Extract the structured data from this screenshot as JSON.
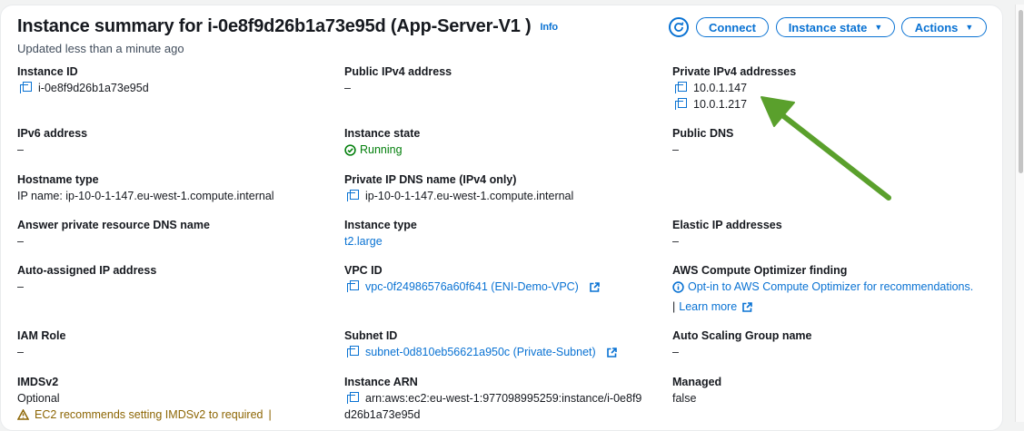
{
  "header": {
    "title": "Instance summary for i-0e8f9d26b1a73e95d (App-Server-V1 )",
    "info": "Info",
    "updated": "Updated less than a minute ago"
  },
  "buttons": {
    "connect": "Connect",
    "instance_state": "Instance state",
    "actions": "Actions"
  },
  "fields": {
    "instance_id": {
      "label": "Instance ID",
      "value": "i-0e8f9d26b1a73e95d"
    },
    "public_ipv4": {
      "label": "Public IPv4 address",
      "value": "–"
    },
    "private_ipv4": {
      "label": "Private IPv4 addresses",
      "values": [
        "10.0.1.147",
        "10.0.1.217"
      ]
    },
    "ipv6": {
      "label": "IPv6 address",
      "value": "–"
    },
    "instance_state": {
      "label": "Instance state",
      "value": "Running"
    },
    "public_dns": {
      "label": "Public DNS",
      "value": "–"
    },
    "hostname_type": {
      "label": "Hostname type",
      "value": "IP name: ip-10-0-1-147.eu-west-1.compute.internal"
    },
    "private_ip_dns": {
      "label": "Private IP DNS name (IPv4 only)",
      "value": "ip-10-0-1-147.eu-west-1.compute.internal"
    },
    "answer_private_dns": {
      "label": "Answer private resource DNS name",
      "value": "–"
    },
    "instance_type": {
      "label": "Instance type",
      "value": "t2.large"
    },
    "elastic_ip": {
      "label": "Elastic IP addresses",
      "value": "–"
    },
    "auto_assigned_ip": {
      "label": "Auto-assigned IP address",
      "value": "–"
    },
    "vpc_id": {
      "label": "VPC ID",
      "value": "vpc-0f24986576a60f641 (ENI-Demo-VPC)"
    },
    "compute_optimizer": {
      "label": "AWS Compute Optimizer finding",
      "value": "Opt-in to AWS Compute Optimizer for recommendations.",
      "learn_more": "Learn more"
    },
    "iam_role": {
      "label": "IAM Role",
      "value": "–"
    },
    "subnet_id": {
      "label": "Subnet ID",
      "value": "subnet-0d810eb56621a950c (Private-Subnet)"
    },
    "auto_scaling": {
      "label": "Auto Scaling Group name",
      "value": "–"
    },
    "imdsv2": {
      "label": "IMDSv2",
      "value": "Optional",
      "warning": "EC2 recommends setting IMDSv2 to required"
    },
    "instance_arn": {
      "label": "Instance ARN",
      "value_line1": "arn:aws:ec2:eu-west-1:977098995259:instance/i-0e8f9",
      "value_line2": "d26b1a73e95d"
    },
    "managed": {
      "label": "Managed",
      "value": "false"
    }
  },
  "colors": {
    "link": "#0972d3",
    "running": "#037f0c",
    "arrow": "#5aa02c",
    "warning": "#8d6605"
  }
}
